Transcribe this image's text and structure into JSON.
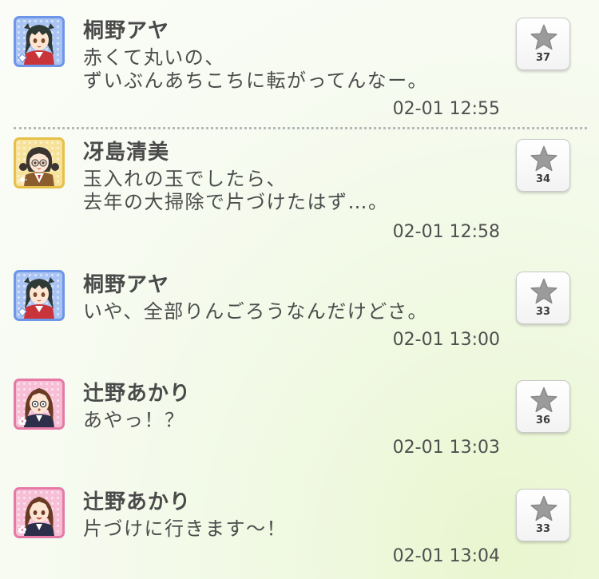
{
  "posts": [
    {
      "name": "桐野アヤ",
      "lines": [
        "赤くて丸いの、",
        "ずいぶんあちこちに転がってんなー。"
      ],
      "timestamp": "02-01 12:55",
      "likes": "37",
      "avatar": "aya"
    },
    {
      "name": "冴島清美",
      "lines": [
        "玉入れの玉でしたら、",
        "去年の大掃除で片づけたはず…。"
      ],
      "timestamp": "02-01 12:58",
      "likes": "34",
      "avatar": "kiyomi"
    },
    {
      "name": "桐野アヤ",
      "lines": [
        "いや、全部りんごろうなんだけどさ。"
      ],
      "timestamp": "02-01 13:00",
      "likes": "33",
      "avatar": "aya"
    },
    {
      "name": "辻野あかり",
      "lines": [
        "あやっ！？"
      ],
      "timestamp": "02-01 13:03",
      "likes": "36",
      "avatar": "akari"
    },
    {
      "name": "辻野あかり",
      "lines": [
        "片づけに行きます〜！"
      ],
      "timestamp": "02-01 13:04",
      "likes": "33",
      "avatar": "akari"
    }
  ],
  "icons": {
    "like": "star-icon",
    "avatar_badge_blue": "gem-badge-icon",
    "avatar_badge_yellow": "sun-badge-icon",
    "avatar_badge_pink": "flower-badge-icon"
  },
  "colors": {
    "frame_blue": "#6d95e8",
    "frame_yellow": "#e7c04a",
    "frame_pink": "#e67aa7",
    "star": "#9b9b9b",
    "text": "#4a4a4a"
  }
}
